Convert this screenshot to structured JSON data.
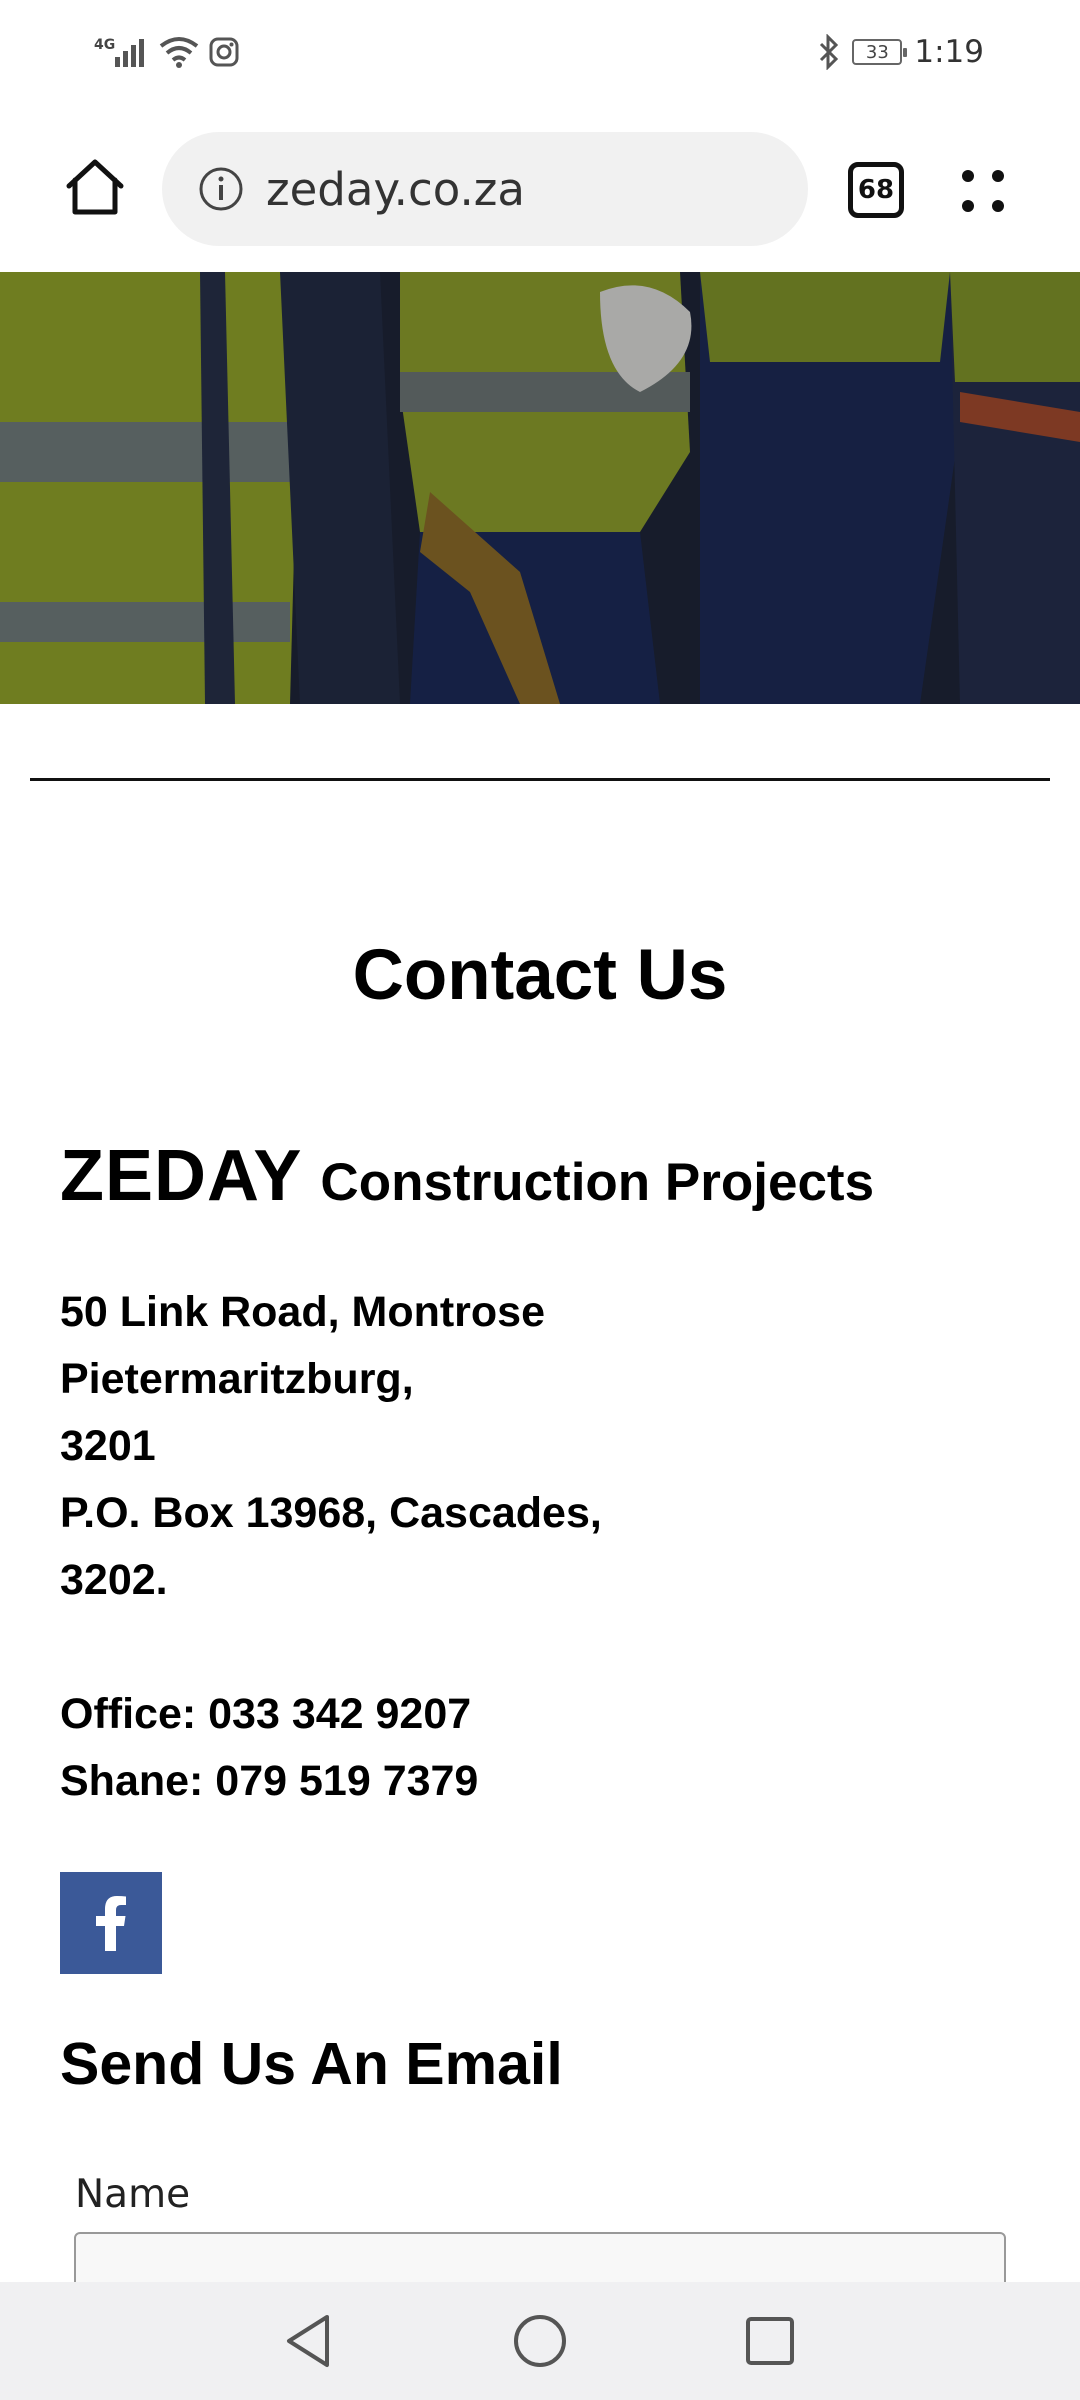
{
  "status_bar": {
    "network": "4G",
    "battery": "33",
    "time": "1:19"
  },
  "browser": {
    "url": "zeday.co.za",
    "tab_count": "68"
  },
  "page": {
    "contact_title": "Contact Us",
    "company_brand": "ZEDAY",
    "company_rest": "Construction Projects",
    "address_lines": [
      "50 Link Road, Montrose",
      "Pietermaritzburg,",
      "3201",
      "P.O. Box 13968, Cascades,",
      "3202."
    ],
    "office_phone": "Office: 033 342 9207",
    "shane_phone": "Shane: 079 519 7379",
    "social_icon": "facebook-icon",
    "email_title": "Send Us An Email",
    "name_label": "Name",
    "name_value": ""
  },
  "colors": {
    "facebook": "#3b5998",
    "nav_bar": "#f0f0f2",
    "url_pill": "#f1f1f1"
  }
}
